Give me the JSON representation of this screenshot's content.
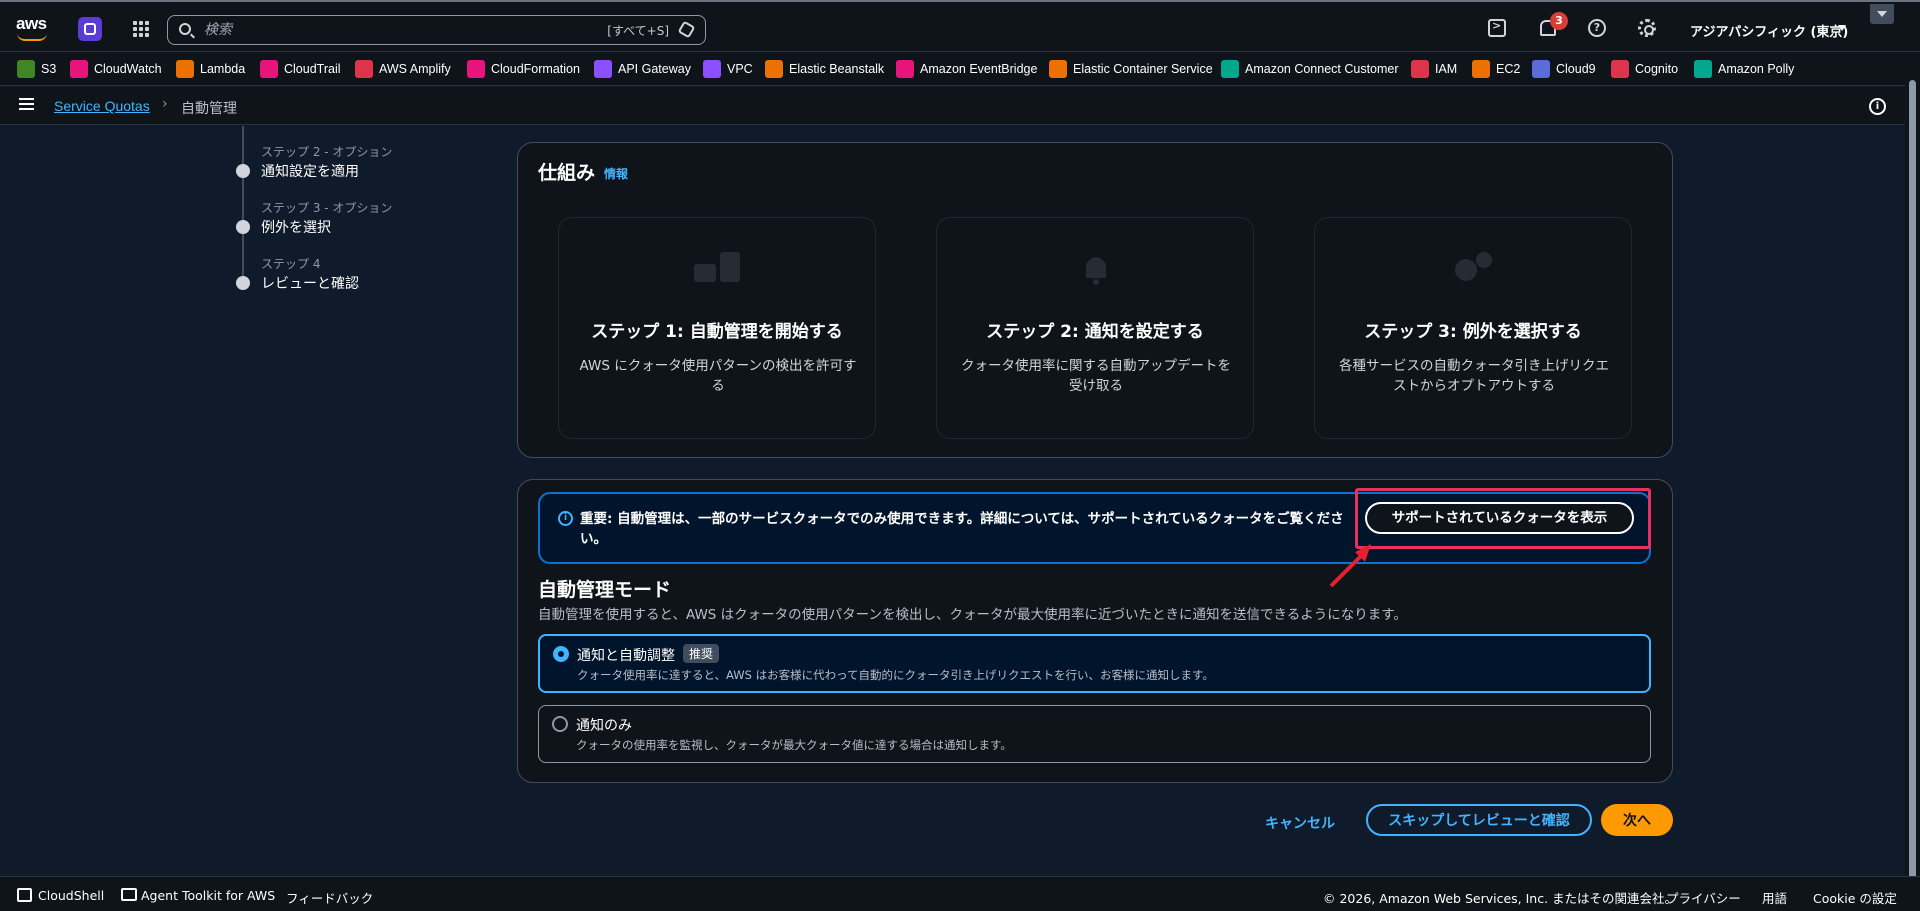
{
  "topnav": {
    "logo_text": "aws",
    "search_placeholder": "検索",
    "search_shortcut": "[すべて+S]",
    "notification_count": "3",
    "region": "アジアパシフィック (東京)"
  },
  "favorites": [
    {
      "label": "S3",
      "color": "#3f8624"
    },
    {
      "label": "CloudWatch",
      "color": "#e7157b"
    },
    {
      "label": "Lambda",
      "color": "#ed7100"
    },
    {
      "label": "CloudTrail",
      "color": "#e7157b"
    },
    {
      "label": "AWS Amplify",
      "color": "#dd344c"
    },
    {
      "label": "CloudFormation",
      "color": "#e7157b"
    },
    {
      "label": "API Gateway",
      "color": "#8c4fff"
    },
    {
      "label": "VPC",
      "color": "#8c4fff"
    },
    {
      "label": "Elastic Beanstalk",
      "color": "#ed7100"
    },
    {
      "label": "Amazon EventBridge",
      "color": "#e7157b"
    },
    {
      "label": "Elastic Container Service",
      "color": "#ed7100"
    },
    {
      "label": "Amazon Connect Customer",
      "color": "#01a88d"
    },
    {
      "label": "IAM",
      "color": "#dd344c"
    },
    {
      "label": "EC2",
      "color": "#ed7100"
    },
    {
      "label": "Cloud9",
      "color": "#5a6cd9"
    },
    {
      "label": "Cognito",
      "color": "#dd344c"
    },
    {
      "label": "Amazon Polly",
      "color": "#01a88d"
    }
  ],
  "breadcrumb": {
    "service": "Service Quotas",
    "current": "自動管理"
  },
  "steps": [
    {
      "label": "ステップ 2 - オプション",
      "title": "通知設定を適用"
    },
    {
      "label": "ステップ 3 - オプション",
      "title": "例外を選択"
    },
    {
      "label": "ステップ 4",
      "title": "レビューと確認"
    }
  ],
  "how": {
    "title": "仕組み",
    "info": "情報",
    "cards": [
      {
        "title": "ステップ 1: 自動管理を開始する",
        "desc": "AWS にクォータ使用パターンの検出を許可する"
      },
      {
        "title": "ステップ 2: 通知を設定する",
        "desc": "クォータ使用率に関する自動アップデートを受け取る"
      },
      {
        "title": "ステップ 3: 例外を選択する",
        "desc": "各種サービスの自動クォータ引き上げリクエストからオプトアウトする"
      }
    ]
  },
  "alert": {
    "text": "重要: 自動管理は、一部のサービスクォータでのみ使用できます。詳細については、サポートされているクォータをご覧ください。",
    "button": "サポートされているクォータを表示"
  },
  "mode": {
    "title": "自動管理モード",
    "desc": "自動管理を使用すると、AWS はクォータの使用パターンを検出し、クォータが最大使用率に近づいたときに通知を送信できるようになります。",
    "options": [
      {
        "title": "通知と自動調整",
        "tag": "推奨",
        "desc": "クォータ使用率に達すると、AWS はお客様に代わって自動的にクォータ引き上げリクエストを行い、お客様に通知します。",
        "selected": true
      },
      {
        "title": "通知のみ",
        "desc": "クォータの使用率を監視し、クォータが最大クォータ値に達する場合は通知します。",
        "selected": false
      }
    ]
  },
  "actions": {
    "cancel": "キャンセル",
    "skip": "スキップしてレビューと確認",
    "next": "次へ"
  },
  "footer": {
    "cloudshell": "CloudShell",
    "agent_toolkit": "Agent Toolkit for AWS",
    "feedback": "フィードバック",
    "copyright": "© 2026, Amazon Web Services, Inc. またはその関連会社。",
    "privacy": "プライバシー",
    "terms": "用語",
    "cookie": "Cookie の設定"
  }
}
